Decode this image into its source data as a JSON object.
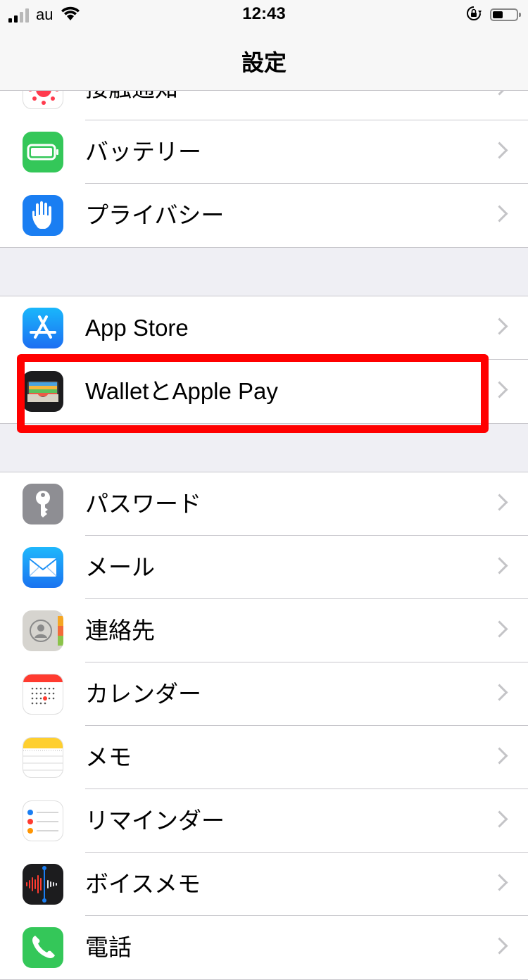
{
  "status_bar": {
    "carrier": "au",
    "time": "12:43"
  },
  "nav": {
    "title": "設定"
  },
  "colors": {
    "highlight": "#ff0000",
    "background": "#efeff4"
  },
  "groups": [
    {
      "rows": [
        {
          "label": "接触通知",
          "icon": "exposure-notification-icon"
        },
        {
          "label": "バッテリー",
          "icon": "battery-icon"
        },
        {
          "label": "プライバシー",
          "icon": "privacy-hand-icon"
        }
      ]
    },
    {
      "rows": [
        {
          "label": "App Store",
          "icon": "app-store-icon"
        },
        {
          "label": "WalletとApple Pay",
          "icon": "wallet-icon"
        }
      ]
    },
    {
      "rows": [
        {
          "label": "パスワード",
          "icon": "key-icon"
        },
        {
          "label": "メール",
          "icon": "mail-icon"
        },
        {
          "label": "連絡先",
          "icon": "contacts-icon"
        },
        {
          "label": "カレンダー",
          "icon": "calendar-icon"
        },
        {
          "label": "メモ",
          "icon": "notes-icon"
        },
        {
          "label": "リマインダー",
          "icon": "reminders-icon"
        },
        {
          "label": "ボイスメモ",
          "icon": "voice-memos-icon"
        },
        {
          "label": "電話",
          "icon": "phone-icon"
        }
      ]
    }
  ]
}
